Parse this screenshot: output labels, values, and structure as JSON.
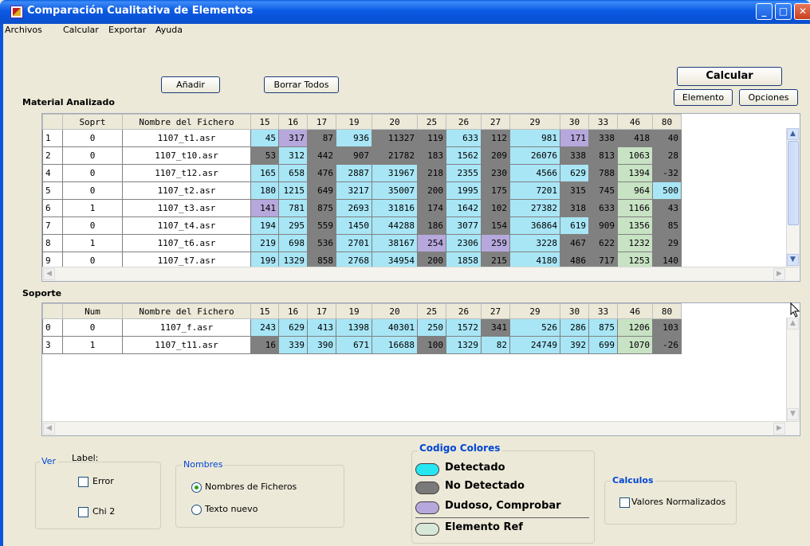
{
  "window": {
    "title": "Comparación Cualitativa de Elementos"
  },
  "menu": [
    "Archivos",
    "Calcular",
    "Exportar",
    "Ayuda"
  ],
  "buttons": {
    "add": "Añadir",
    "clear_all": "Borrar Todos",
    "calculate": "Calcular",
    "element": "Elemento",
    "options": "Opciones"
  },
  "material": {
    "label": "Material Analizado",
    "columns": [
      "",
      "Soprt",
      "Nombre del Fichero",
      "15",
      "16",
      "17",
      "19",
      "20",
      "25",
      "26",
      "27",
      "29",
      "30",
      "33",
      "46",
      "80"
    ],
    "rows": [
      {
        "idx": "1",
        "sop": "0",
        "name": "1107_t1.asr",
        "vals": [
          "45",
          "317",
          "87",
          "936",
          "11327",
          "119",
          "633",
          "112",
          "981",
          "171",
          "338",
          "418",
          "40"
        ],
        "cls": [
          "det",
          "dud",
          "nodet",
          "det",
          "nodet",
          "nodet",
          "det",
          "nodet",
          "det",
          "dud",
          "nodet",
          "nodet",
          "nodet"
        ]
      },
      {
        "idx": "2",
        "sop": "0",
        "name": "1107_t10.asr",
        "vals": [
          "53",
          "312",
          "442",
          "907",
          "21782",
          "183",
          "1562",
          "209",
          "26076",
          "338",
          "813",
          "1063",
          "28"
        ],
        "cls": [
          "nodet",
          "det",
          "nodet",
          "nodet",
          "nodet",
          "nodet",
          "det",
          "nodet",
          "det",
          "nodet",
          "nodet",
          "ref",
          "nodet"
        ]
      },
      {
        "idx": "4",
        "sop": "0",
        "name": "1107_t12.asr",
        "vals": [
          "165",
          "658",
          "476",
          "2887",
          "31967",
          "218",
          "2355",
          "230",
          "4566",
          "629",
          "788",
          "1394",
          "-32"
        ],
        "cls": [
          "det",
          "det",
          "nodet",
          "det",
          "det",
          "nodet",
          "det",
          "nodet",
          "det",
          "det",
          "nodet",
          "ref",
          "nodet"
        ]
      },
      {
        "idx": "5",
        "sop": "0",
        "name": "1107_t2.asr",
        "vals": [
          "180",
          "1215",
          "649",
          "3217",
          "35007",
          "200",
          "1995",
          "175",
          "7201",
          "315",
          "745",
          "964",
          "500"
        ],
        "cls": [
          "det",
          "det",
          "nodet",
          "det",
          "det",
          "nodet",
          "det",
          "nodet",
          "det",
          "nodet",
          "nodet",
          "ref",
          "det"
        ]
      },
      {
        "idx": "6",
        "sop": "1",
        "name": "1107_t3.asr",
        "vals": [
          "141",
          "781",
          "875",
          "2693",
          "31816",
          "174",
          "1642",
          "102",
          "27382",
          "318",
          "633",
          "1166",
          "43"
        ],
        "cls": [
          "dud",
          "det",
          "nodet",
          "det",
          "det",
          "nodet",
          "det",
          "nodet",
          "det",
          "nodet",
          "nodet",
          "ref",
          "nodet"
        ]
      },
      {
        "idx": "7",
        "sop": "0",
        "name": "1107_t4.asr",
        "vals": [
          "194",
          "295",
          "559",
          "1450",
          "44288",
          "186",
          "3077",
          "154",
          "36864",
          "619",
          "909",
          "1356",
          "85"
        ],
        "cls": [
          "det",
          "det",
          "nodet",
          "det",
          "det",
          "nodet",
          "det",
          "nodet",
          "det",
          "det",
          "nodet",
          "ref",
          "nodet"
        ]
      },
      {
        "idx": "8",
        "sop": "1",
        "name": "1107_t6.asr",
        "vals": [
          "219",
          "698",
          "536",
          "2701",
          "38167",
          "254",
          "2306",
          "259",
          "3228",
          "467",
          "622",
          "1232",
          "29"
        ],
        "cls": [
          "det",
          "det",
          "nodet",
          "det",
          "det",
          "dud",
          "det",
          "dud",
          "det",
          "nodet",
          "nodet",
          "ref",
          "nodet"
        ]
      },
      {
        "idx": "9",
        "sop": "0",
        "name": "1107_t7.asr",
        "vals": [
          "199",
          "1329",
          "858",
          "2768",
          "34954",
          "200",
          "1858",
          "215",
          "4180",
          "486",
          "717",
          "1253",
          "140"
        ],
        "cls": [
          "det",
          "det",
          "nodet",
          "det",
          "det",
          "nodet",
          "det",
          "nodet",
          "det",
          "nodet",
          "nodet",
          "ref",
          "nodet"
        ]
      }
    ]
  },
  "soporte": {
    "label": "Soporte",
    "columns": [
      "",
      "Num",
      "Nombre del Fichero",
      "15",
      "16",
      "17",
      "19",
      "20",
      "25",
      "26",
      "27",
      "29",
      "30",
      "33",
      "46",
      "80"
    ],
    "rows": [
      {
        "idx": "0",
        "sop": "0",
        "name": "1107_f.asr",
        "vals": [
          "243",
          "629",
          "413",
          "1398",
          "40301",
          "250",
          "1572",
          "341",
          "526",
          "286",
          "875",
          "1206",
          "103"
        ],
        "cls": [
          "det",
          "det",
          "det",
          "det",
          "det",
          "det",
          "det",
          "nodet",
          "det",
          "det",
          "det",
          "ref",
          "nodet"
        ]
      },
      {
        "idx": "3",
        "sop": "1",
        "name": "1107_t11.asr",
        "vals": [
          "16",
          "339",
          "390",
          "671",
          "16688",
          "100",
          "1329",
          "82",
          "24749",
          "392",
          "699",
          "1070",
          "-26"
        ],
        "cls": [
          "nodet",
          "det",
          "det",
          "det",
          "det",
          "nodet",
          "det",
          "det",
          "det",
          "det",
          "det",
          "ref",
          "nodet"
        ]
      }
    ]
  },
  "ver": {
    "title": "Ver",
    "label_title": "Label:",
    "error": "Error",
    "chi2": "Chi 2"
  },
  "nombres": {
    "title": "Nombres",
    "opt1": "Nombres de Ficheros",
    "opt2": "Texto nuevo"
  },
  "colores": {
    "title": "Codigo Colores",
    "detected": "Detectado",
    "not_detected": "No Detectado",
    "dubious": "Dudoso, Comprobar",
    "ref": "Elemento Ref",
    "det_color": "#26e6f2",
    "nodet_color": "#7a7a7a",
    "dud_color": "#b6a8dc",
    "ref_color": "#d8e8d8"
  },
  "calculos": {
    "title": "Calculos",
    "normalized": "Valores Normalizados"
  }
}
